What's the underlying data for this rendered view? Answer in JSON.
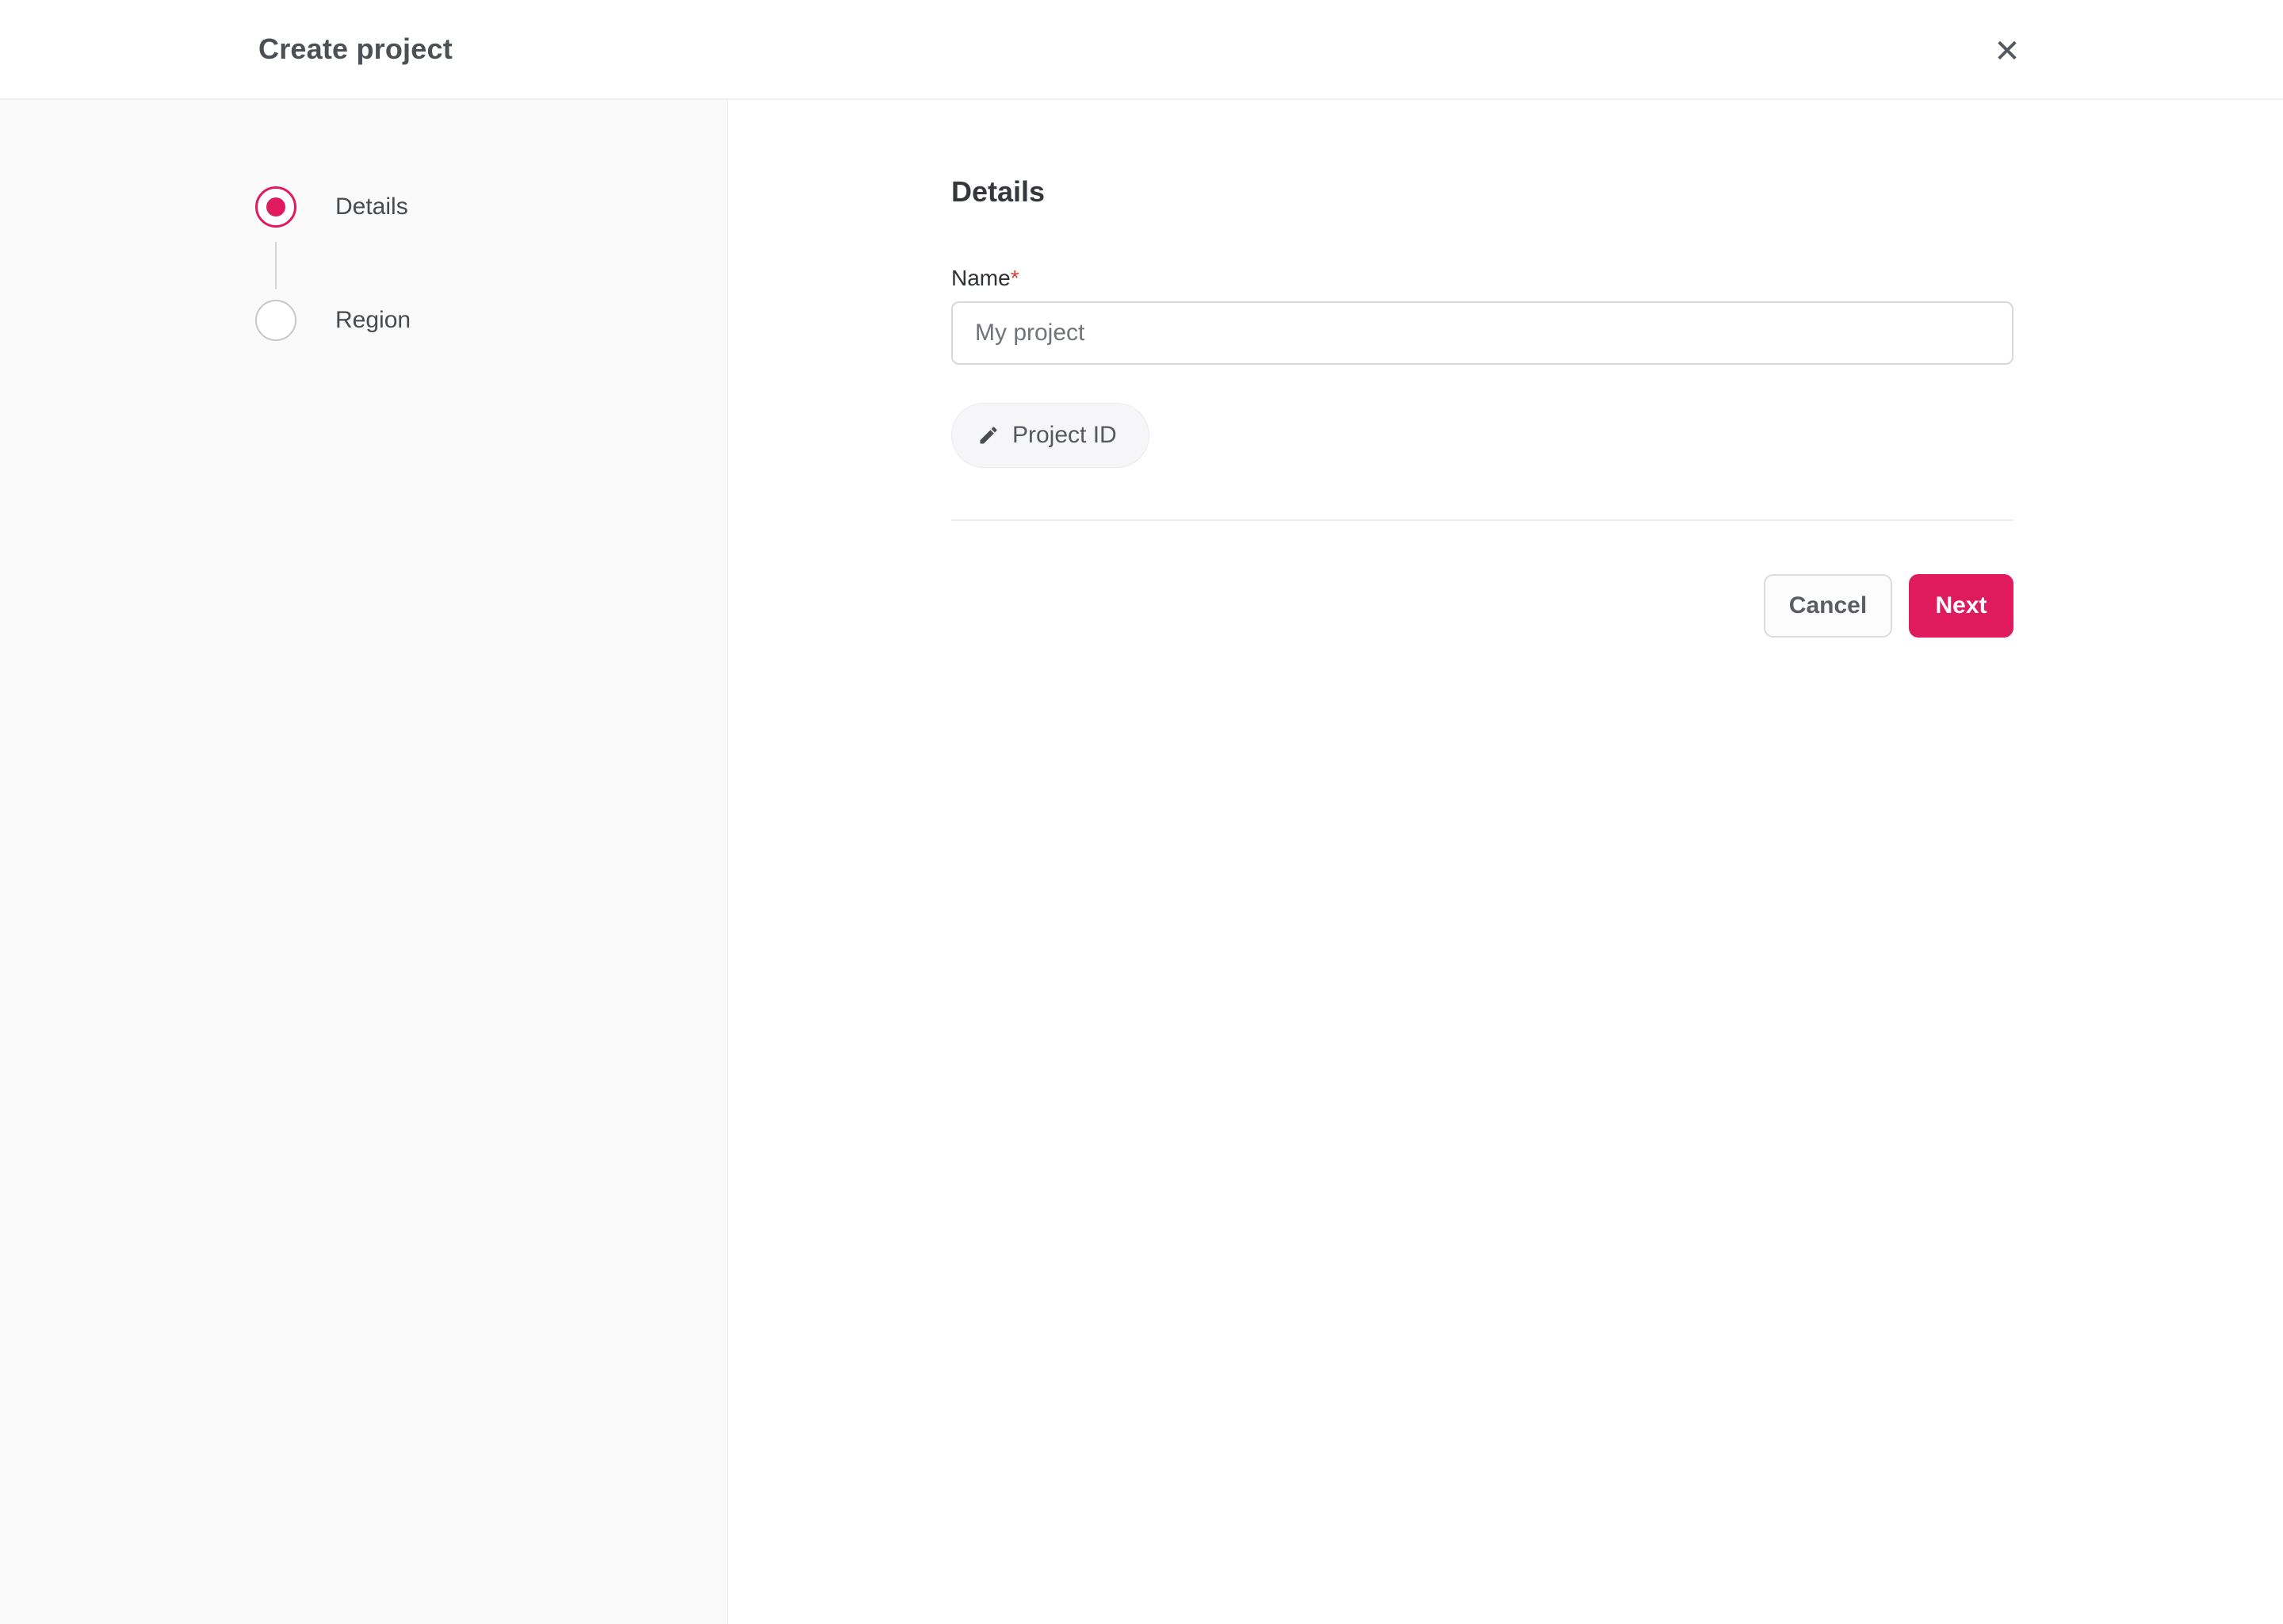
{
  "header": {
    "title": "Create project",
    "close_glyph": "✕"
  },
  "stepper": {
    "steps": [
      {
        "label": "Details",
        "state": "active"
      },
      {
        "label": "Region",
        "state": "upcoming"
      }
    ]
  },
  "content": {
    "heading": "Details",
    "form": {
      "name_label": "Name",
      "required_marker": "*",
      "name_value": "",
      "name_placeholder": "My project"
    },
    "project_id_button": {
      "label": "Project ID",
      "icon": "pencil-icon"
    },
    "actions": {
      "cancel_label": "Cancel",
      "next_label": "Next"
    }
  },
  "colors": {
    "accent": "#e01b5d",
    "required": "#e23b3b",
    "sidebar_bg": "#fafafb",
    "border_subtle": "#ececee",
    "text_primary": "#35373c",
    "text_secondary": "#55585e"
  }
}
